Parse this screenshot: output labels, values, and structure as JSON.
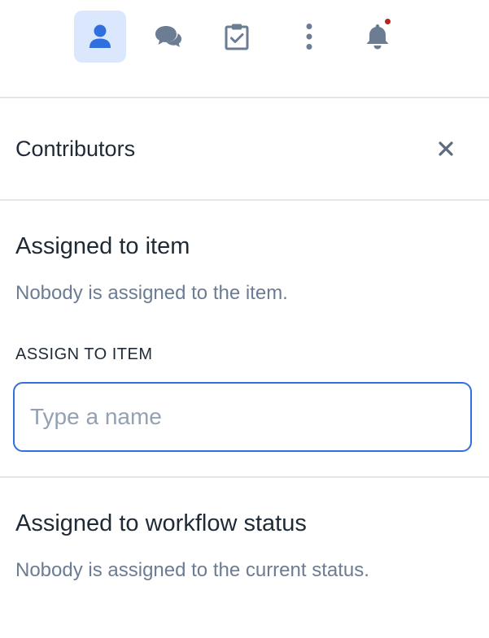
{
  "toolbar": {
    "items": [
      {
        "icon": "person-icon",
        "active": true
      },
      {
        "icon": "chat-bubbles-icon",
        "active": false
      },
      {
        "icon": "clipboard-check-icon",
        "active": false
      },
      {
        "icon": "more-vertical-icon",
        "active": false
      },
      {
        "icon": "bell-icon",
        "active": false,
        "has_notification": true
      }
    ]
  },
  "panel": {
    "title": "Contributors",
    "close_icon": "close-icon"
  },
  "assigned_item": {
    "heading": "Assigned to item",
    "description": "Nobody is assigned to the item.",
    "field_label": "ASSIGN TO ITEM",
    "input_value": "",
    "input_placeholder": "Type a name"
  },
  "assigned_workflow": {
    "heading": "Assigned to workflow status",
    "description": "Nobody is assigned to the current status."
  },
  "colors": {
    "accent": "#2f6fde",
    "active_bg": "#dbe7fd",
    "icon_gray": "#6b7c93",
    "notification": "#b3261e",
    "divider": "#e3e6ea"
  }
}
